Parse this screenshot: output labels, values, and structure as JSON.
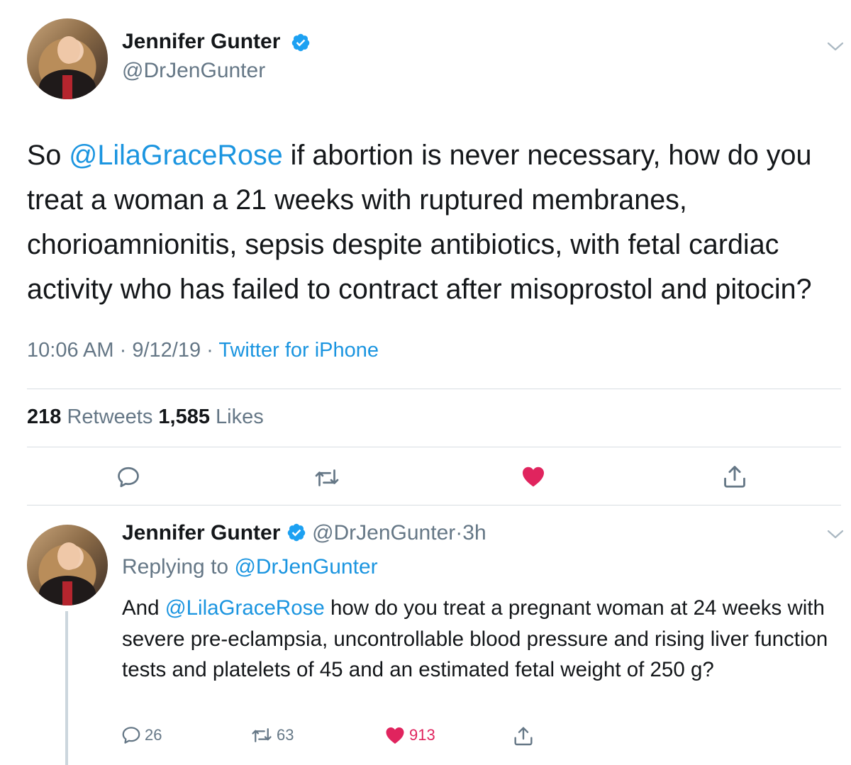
{
  "tweet": {
    "author_name": "Jennifer Gunter",
    "author_handle": "@DrJenGunter",
    "text_prefix": "So ",
    "mention": "@LilaGraceRose",
    "text_rest": " if abortion is never necessary, how do you treat a woman a 21 weeks with ruptured membranes, chorioamnionitis, sepsis despite antibiotics, with fetal cardiac activity who has failed to contract after misoprostol and pitocin?",
    "time": "10:06 AM",
    "date": "9/12/19",
    "separator": "·",
    "source": "Twitter for iPhone",
    "retweets_count": "218",
    "retweets_label": "Retweets",
    "likes_count": "1,585",
    "likes_label": "Likes"
  },
  "reply": {
    "author_name": "Jennifer Gunter",
    "author_handle": "@DrJenGunter",
    "separator": "·",
    "age": "3h",
    "replying_label": "Replying to",
    "replying_handle": "@DrJenGunter",
    "text_prefix": "And ",
    "mention": "@LilaGraceRose",
    "text_rest": " how do you treat a pregnant woman at 24 weeks with severe pre-eclampsia, uncontrollable blood pressure and rising liver function tests and platelets of 45 and an estimated fetal weight of 250 g?",
    "reply_count": "26",
    "retweet_count": "63",
    "like_count": "913"
  },
  "icons": {
    "verified": "verified-badge-icon",
    "chevron": "chevron-down-icon",
    "reply": "reply-icon",
    "retweet": "retweet-icon",
    "like": "heart-icon",
    "share": "share-icon"
  },
  "colors": {
    "link": "#1b95e0",
    "secondary_text": "#657786",
    "liked": "#e0245e",
    "divider": "#d7dde2"
  }
}
